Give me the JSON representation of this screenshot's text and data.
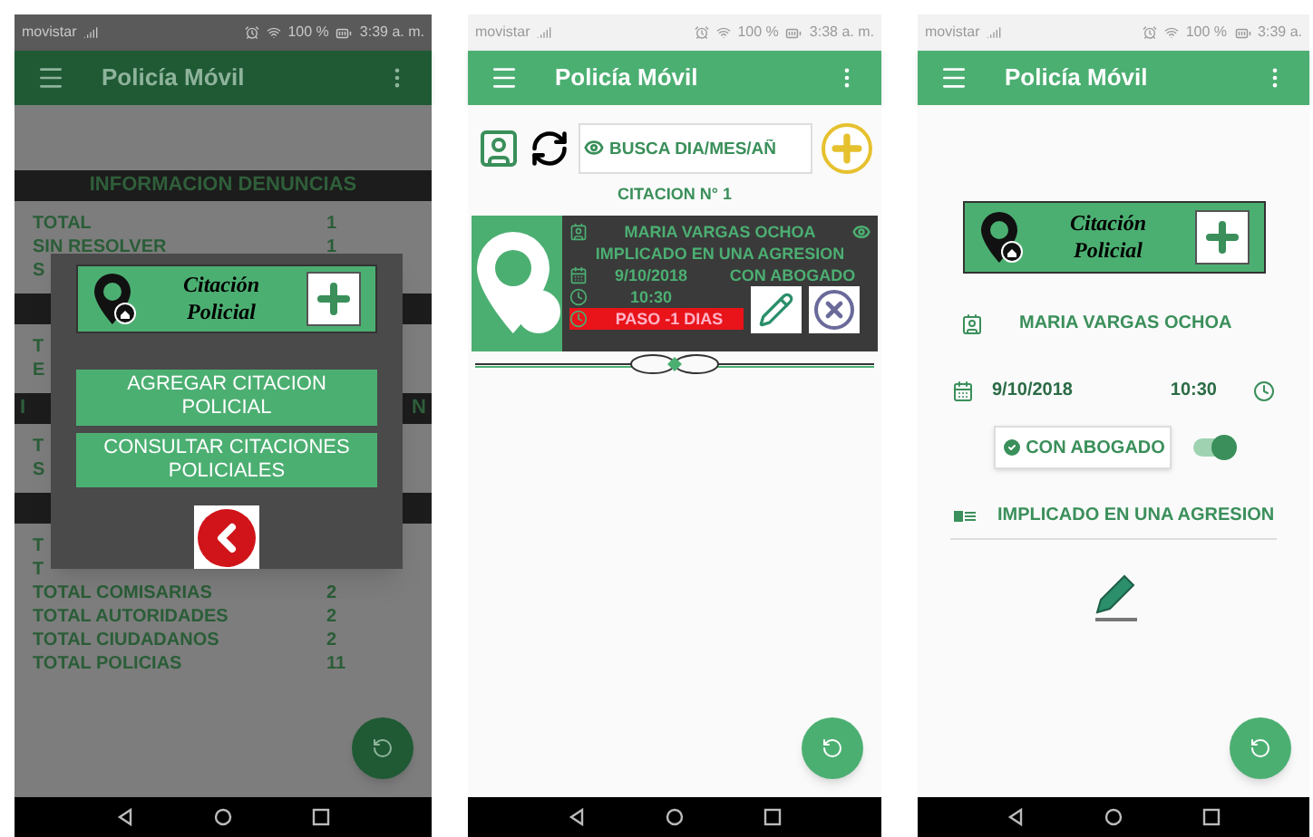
{
  "screen_menu": {
    "dimmed": true,
    "status_bar": {
      "carrier": "movistar",
      "battery": "100 %",
      "time": "3:39 a. m."
    },
    "app_bar": {
      "title": "Policía Móvil"
    },
    "background": [
      {
        "kind": "header",
        "text": "INFORMACION DENUNCIAS"
      },
      {
        "kind": "row",
        "label": "TOTAL",
        "value": "1"
      },
      {
        "kind": "row",
        "label": "SIN RESOLVER",
        "value": "1"
      },
      {
        "kind": "row",
        "label": "S"
      },
      {
        "kind": "header"
      },
      {
        "kind": "row",
        "label": "T"
      },
      {
        "kind": "row",
        "label": "E"
      },
      {
        "kind": "header",
        "left": "I",
        "right": "N"
      },
      {
        "kind": "row",
        "label": "T"
      },
      {
        "kind": "row",
        "label": "S"
      },
      {
        "kind": "header"
      },
      {
        "kind": "row",
        "label": "T"
      },
      {
        "kind": "row",
        "label": "T"
      },
      {
        "kind": "row",
        "label": "TOTAL COMISARIAS",
        "value": "2"
      },
      {
        "kind": "row",
        "label": "TOTAL AUTORIDADES",
        "value": "2"
      },
      {
        "kind": "row",
        "label": "TOTAL CIUDADANOS",
        "value": "2"
      },
      {
        "kind": "row",
        "label": "TOTAL POLICIAS",
        "value": "11"
      }
    ],
    "dialog": {
      "logo_text": "Citación Policial",
      "buttons": [
        "AGREGAR CITACION POLICIAL",
        "CONSULTAR CITACIONES POLICIALES"
      ]
    }
  },
  "screen_list": {
    "dimmed": false,
    "status_bar": {
      "carrier": "movistar",
      "battery": "100 %",
      "time": "3:38 a. m."
    },
    "app_bar": {
      "title": "Policía Móvil"
    },
    "search": {
      "placeholder": "BUSCA DIA/MES/AÑ"
    },
    "list_title": "CITACION N° 1",
    "card": {
      "name": "MARIA VARGAS OCHOA",
      "reason": "IMPLICADO EN UNA AGRESION",
      "date": "9/10/2018",
      "lawyer": "CON ABOGADO",
      "time": "10:30",
      "status": "PASO -1 DIAS"
    }
  },
  "screen_detail": {
    "dimmed": false,
    "status_bar": {
      "carrier": "movistar",
      "battery": "100 %",
      "time": "3:39 a."
    },
    "app_bar": {
      "title": "Policía Móvil"
    },
    "logo_text": "Citación Policial",
    "name": "MARIA VARGAS OCHOA",
    "date": "9/10/2018",
    "time": "10:30",
    "lawyer": {
      "label": "CON ABOGADO",
      "on": true
    },
    "reason": "IMPLICADO EN UNA AGRESION"
  }
}
